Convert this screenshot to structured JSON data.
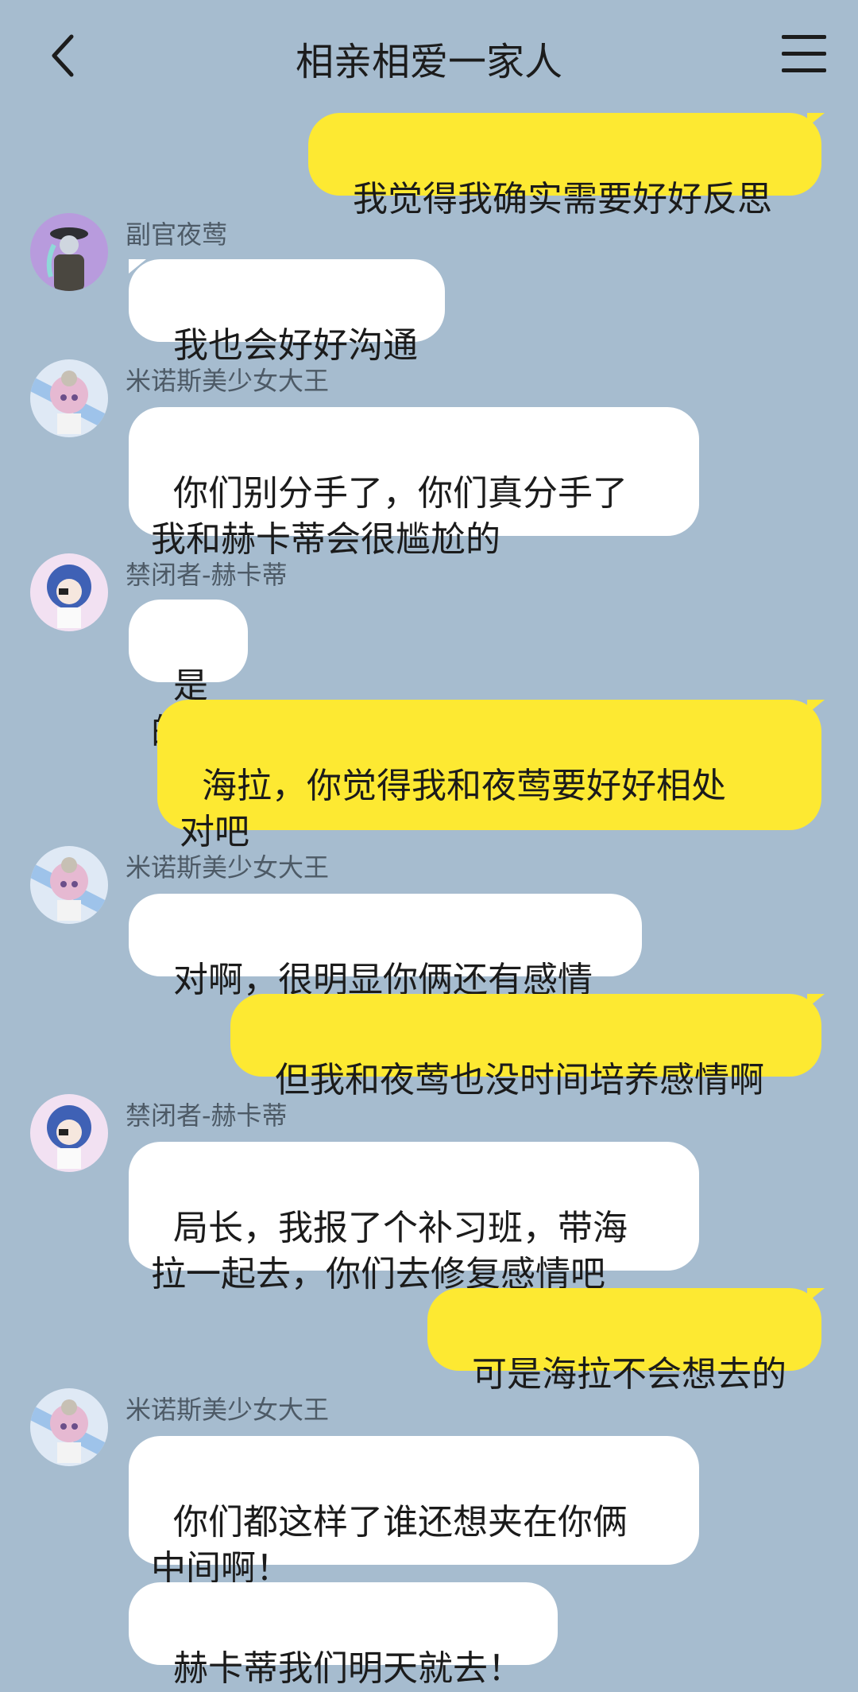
{
  "header": {
    "title": "相亲相爱一家人"
  },
  "colors": {
    "background": "#a6bccf",
    "self_bubble": "#fde932",
    "other_bubble": "#ffffff"
  },
  "messages": [
    {
      "side": "right",
      "text": "我觉得我确实需要好好反思"
    },
    {
      "side": "left",
      "sender": "副官夜莺",
      "avatar": "avatar-nightingale",
      "text": "我也会好好沟通"
    },
    {
      "side": "left",
      "sender": "米诺斯美少女大王",
      "avatar": "avatar-minos",
      "text": "你们别分手了，你们真分手了\n我和赫卡蒂会很尴尬的"
    },
    {
      "side": "left",
      "sender": "禁闭者-赫卡蒂",
      "avatar": "avatar-hecate",
      "text": "是的"
    },
    {
      "side": "right",
      "text": "海拉，你觉得我和夜莺要好好相处\n对吧"
    },
    {
      "side": "left",
      "sender": "米诺斯美少女大王",
      "avatar": "avatar-minos",
      "text": "对啊，很明显你俩还有感情"
    },
    {
      "side": "right",
      "text": "但我和夜莺也没时间培养感情啊"
    },
    {
      "side": "left",
      "sender": "禁闭者-赫卡蒂",
      "avatar": "avatar-hecate",
      "text": "局长，我报了个补习班，带海\n拉一起去，你们去修复感情吧"
    },
    {
      "side": "right",
      "text": "可是海拉不会想去的"
    },
    {
      "side": "left",
      "sender": "米诺斯美少女大王",
      "avatar": "avatar-minos",
      "text": "你们都这样了谁还想夹在你俩\n中间啊！"
    },
    {
      "side": "left",
      "text": "赫卡蒂我们明天就去！"
    }
  ]
}
